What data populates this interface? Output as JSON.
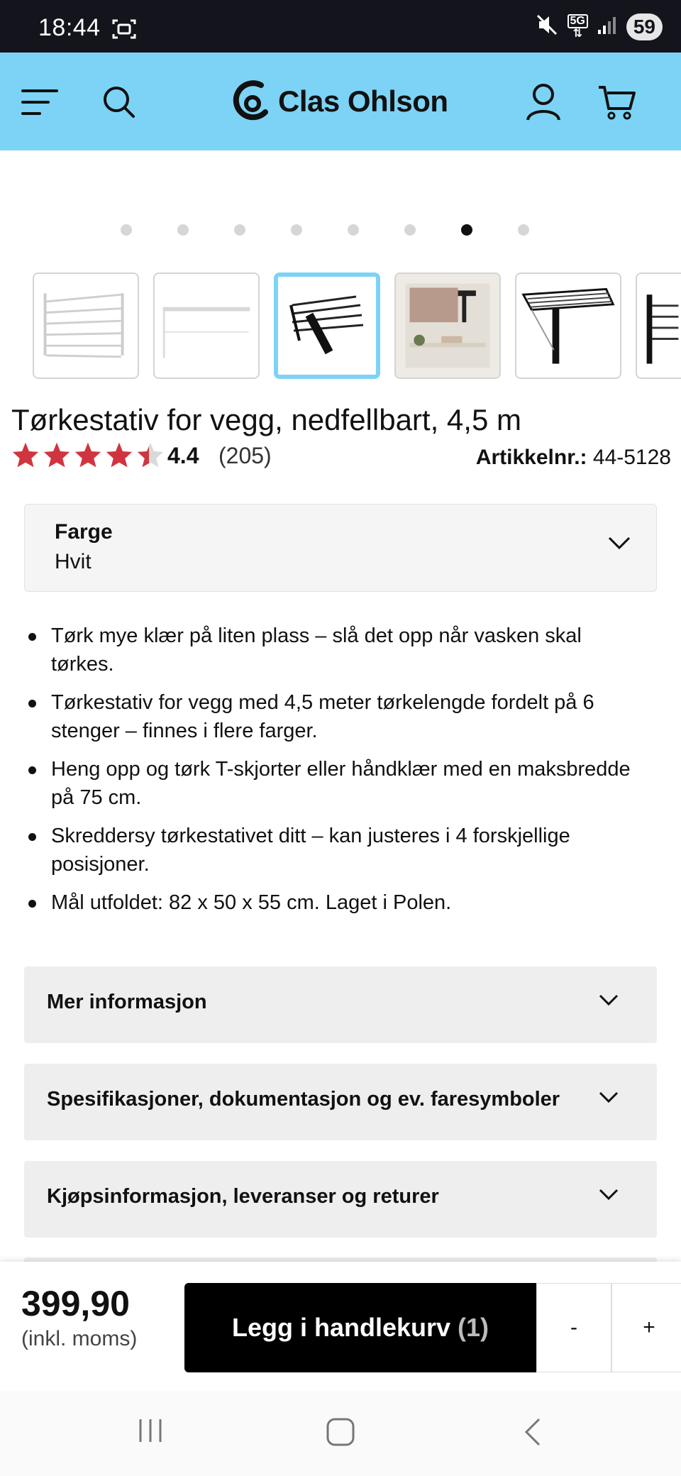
{
  "status_bar": {
    "time": "18:44",
    "network": "5G",
    "battery": "59"
  },
  "header": {
    "brand": "Clas Ohlson",
    "icons": [
      "menu-icon",
      "search-icon",
      "account-icon",
      "cart-icon"
    ],
    "background_color": "#7dd3f5"
  },
  "carousel": {
    "total_dots": 8,
    "active_dot": 7,
    "thumbnails": [
      "image-1",
      "image-2",
      "image-3",
      "image-4",
      "image-5",
      "image-6"
    ],
    "active_thumbnail": 3
  },
  "product": {
    "title": "Tørkestativ for vegg, nedfellbart, 4,5 m",
    "rating": "4.4",
    "rating_value": 4.4,
    "review_count": "(205)",
    "article_label": "Artikkelnr.:",
    "article_number": "44-5128"
  },
  "color_select": {
    "label": "Farge",
    "value": "Hvit"
  },
  "features": [
    "Tørk mye klær på liten plass – slå det opp når vasken skal tørkes.",
    "Tørkestativ for vegg med 4,5 meter tørkelengde fordelt på 6 stenger – finnes i flere farger.",
    "Heng opp og tørk T-skjorter eller håndklær med en maksbredde på 75 cm.",
    "Skreddersy tørkestativet ditt – kan justeres i 4 forskjellige posisjoner.",
    "Mål utfoldet: 82 x 50 x 55 cm. Laget i Polen."
  ],
  "accordions": [
    "Mer informasjon",
    "Spesifikasjoner, dokumentasjon og ev. faresymboler",
    "Kjøpsinformasjon, leveranser og returer"
  ],
  "purchase": {
    "price": "399,90",
    "price_note": "(inkl. moms)",
    "add_to_cart": "Legg i handlekurv",
    "cart_count": "(1)",
    "minus": "-",
    "plus": "+"
  },
  "colors": {
    "accent": "#7dd3f5",
    "star": "#d0353f",
    "button": "#000000"
  }
}
